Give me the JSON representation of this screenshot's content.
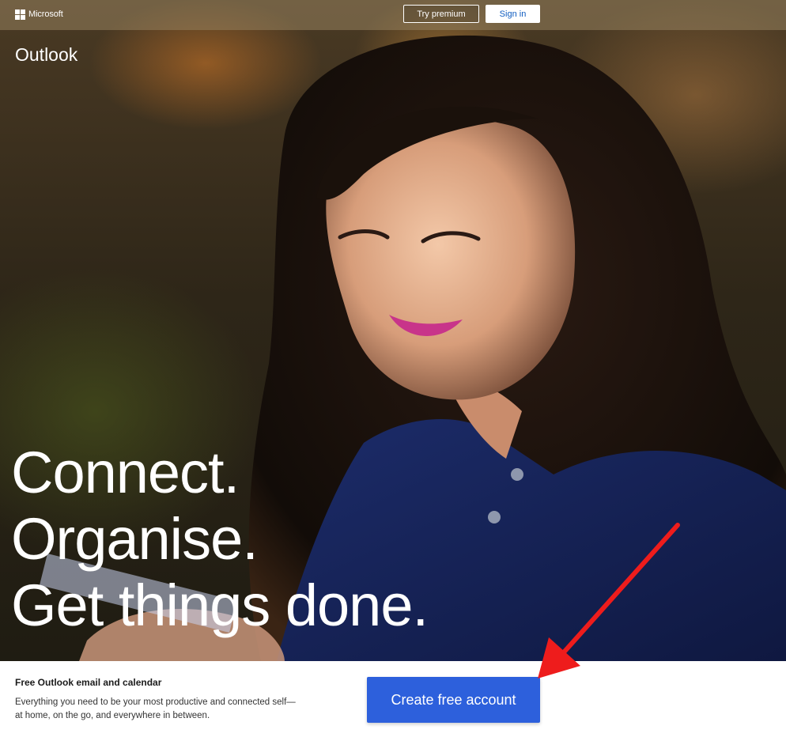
{
  "header": {
    "brand_label": "Microsoft",
    "try_premium_label": "Try premium",
    "sign_in_label": "Sign in"
  },
  "hero": {
    "product_name": "Outlook",
    "headline_lines": [
      "Connect.",
      "Organise.",
      "Get things done."
    ]
  },
  "footer_cta": {
    "title": "Free Outlook email and calendar",
    "description": "Everything you need to be your most productive and connected self—at home, on the go, and everywhere in between.",
    "button_label": "Create free account"
  },
  "colors": {
    "cta_button": "#2d60dc",
    "sign_in_text": "#0f5cc0",
    "annotation_arrow": "#ee1c1c"
  },
  "icons": [
    "microsoft-logo-icon",
    "annotation-arrow-icon"
  ]
}
